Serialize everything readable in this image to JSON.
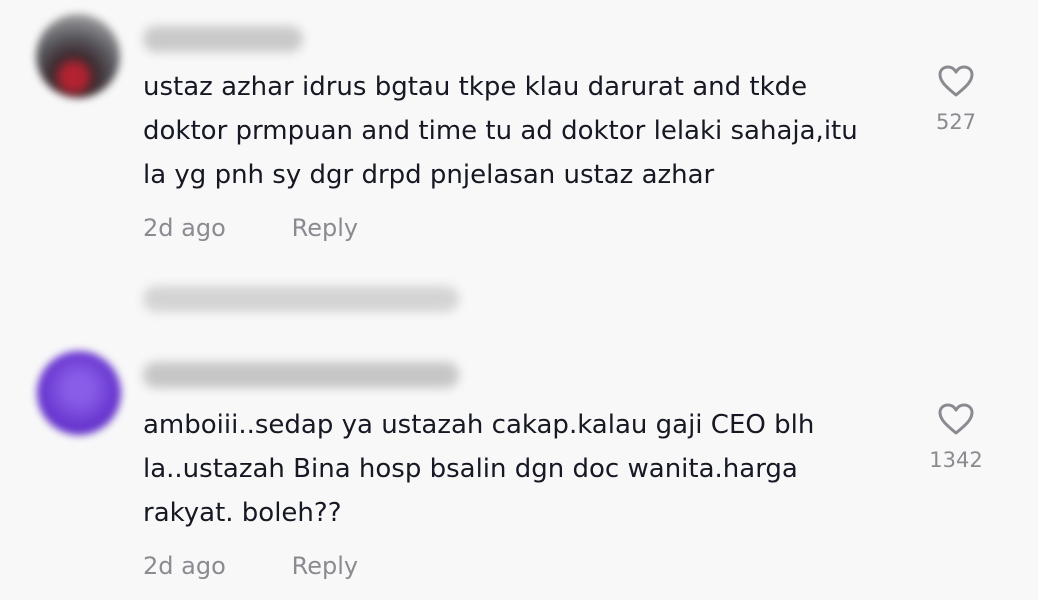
{
  "comments": [
    {
      "text": "ustaz azhar idrus bgtau tkpe klau darurat and tkde\ndoktor prmpuan and time tu ad doktor lelaki sahaja,itu\nla yg pnh sy dgr drpd pnjelasan ustaz azhar",
      "time": "2d ago",
      "reply_label": "Reply",
      "likes": "527",
      "like_icon": "heart-outline-icon"
    },
    {
      "text": "amboiii..sedap ya ustazah cakap.kalau gaji CEO blh\nla..ustazah Bina hosp bsalin dgn doc wanita.harga\nrakyat. boleh??",
      "time": "2d ago",
      "reply_label": "Reply",
      "likes": "1342",
      "like_icon": "heart-outline-icon"
    }
  ],
  "colors": {
    "background": "#f8f8f8",
    "text": "#161823",
    "muted": "#8a8b91"
  }
}
